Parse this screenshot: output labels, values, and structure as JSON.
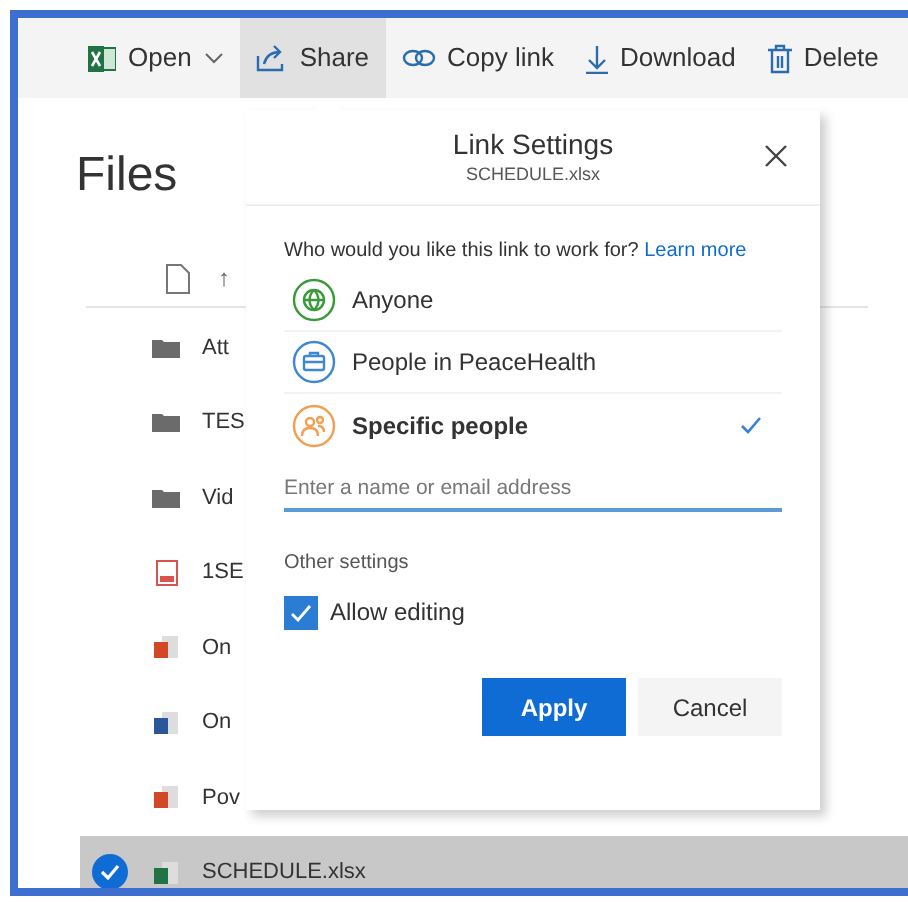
{
  "toolbar": [
    {
      "label": "Open",
      "kind": "excel",
      "caret": true,
      "selected": false
    },
    {
      "label": "Share",
      "kind": "share",
      "caret": false,
      "selected": true
    },
    {
      "label": "Copy link",
      "kind": "link",
      "caret": false,
      "selected": false
    },
    {
      "label": "Download",
      "kind": "download",
      "caret": false,
      "selected": false
    },
    {
      "label": "Delete",
      "kind": "trash",
      "caret": false,
      "selected": false
    }
  ],
  "page_title": "Files",
  "list_header": {
    "sort_arrow": "↑"
  },
  "files": [
    {
      "name": "Att",
      "kind": "folder",
      "selected": false
    },
    {
      "name": "TES",
      "kind": "folder",
      "selected": false
    },
    {
      "name": "Vid",
      "kind": "folder",
      "selected": false
    },
    {
      "name": "1SE",
      "kind": "pdf",
      "selected": false
    },
    {
      "name": "On",
      "kind": "powerpoint",
      "selected": false
    },
    {
      "name": "On",
      "kind": "word",
      "selected": false
    },
    {
      "name": "Pov",
      "kind": "powerpoint",
      "selected": false
    },
    {
      "name": "SCHEDULE.xlsx",
      "kind": "excel",
      "selected": true
    }
  ],
  "dialog": {
    "title": "Link Settings",
    "subtitle": "SCHEDULE.xlsx",
    "question": "Who would you like this link to work for?",
    "learn_more": "Learn more",
    "options": [
      {
        "label": "Anyone",
        "kind": "globe",
        "selected": false
      },
      {
        "label": "People in PeaceHealth",
        "kind": "org",
        "selected": false
      },
      {
        "label": "Specific people",
        "kind": "people",
        "selected": true
      }
    ],
    "recipient_field": {
      "placeholder": "Enter a name or email address"
    },
    "other_settings": "Other settings",
    "allow_editing": {
      "label": "Allow editing",
      "checked": true
    },
    "buttons": [
      {
        "label": "Apply",
        "kind": "primary"
      },
      {
        "label": "Cancel",
        "kind": "secondary"
      }
    ]
  }
}
